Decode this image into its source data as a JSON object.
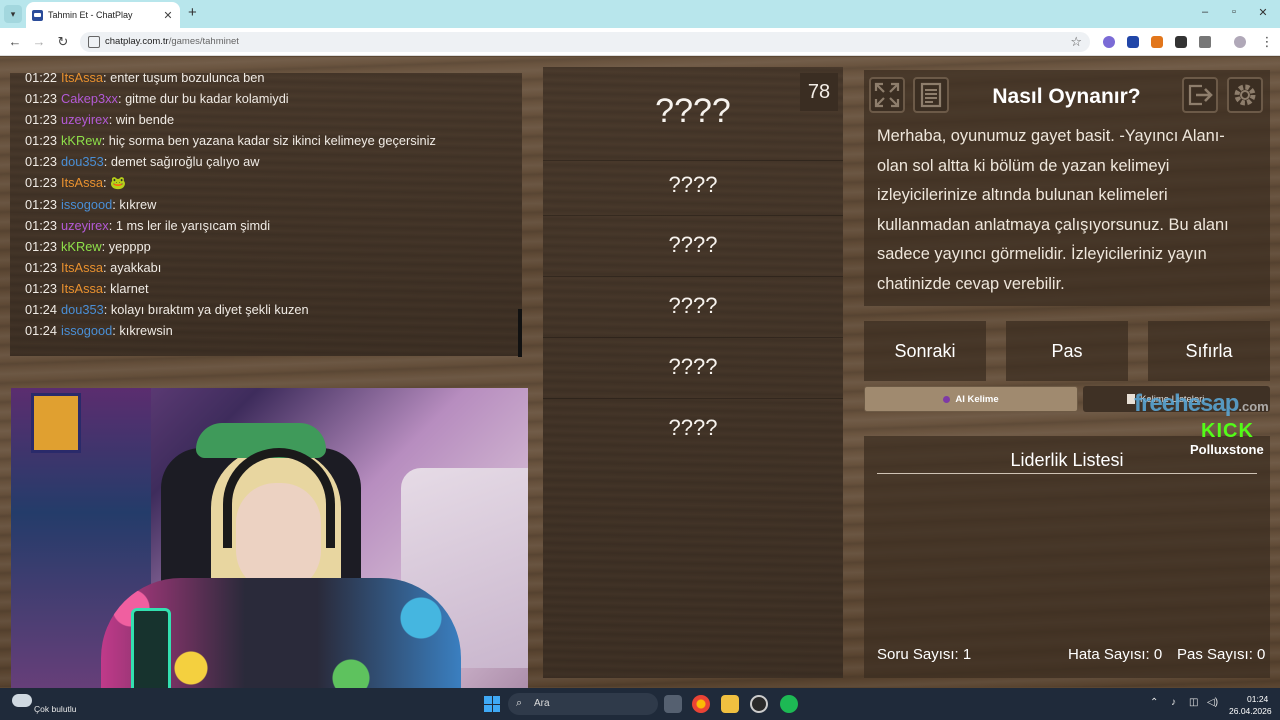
{
  "browser": {
    "tab_title": "Tahmin Et - ChatPlay",
    "new_tab": "+",
    "url_host": "chatplay.com.tr",
    "url_path": "/games/tahminet",
    "window_controls": [
      "–",
      "▫",
      "✕"
    ]
  },
  "chat": {
    "messages": [
      {
        "time": "01:22",
        "user": "ItsAssa",
        "color": "#e9912f",
        "text": "enter tuşum bozulunca ben"
      },
      {
        "time": "01:23",
        "user": "Cakep3xx",
        "color": "#b35ad6",
        "text": "gitme dur bu kadar kolamiydi"
      },
      {
        "time": "01:23",
        "user": "uzeyirex",
        "color": "#b35ad6",
        "text": "win bende"
      },
      {
        "time": "01:23",
        "user": "kKRew",
        "color": "#8ee04a",
        "text": "hiç sorma ben yazana kadar siz ikinci kelimeye geçersiniz"
      },
      {
        "time": "01:23",
        "user": "dou353",
        "color": "#4a8fd6",
        "text": "demet sağıroğlu çalıyo aw"
      },
      {
        "time": "01:23",
        "user": "ItsAssa",
        "color": "#e9912f",
        "text": "🐸"
      },
      {
        "time": "01:23",
        "user": "issogood",
        "color": "#4a8fd6",
        "text": "kıkrew"
      },
      {
        "time": "01:23",
        "user": "uzeyirex",
        "color": "#b35ad6",
        "text": "1 ms ler ile yarışıcam şimdi"
      },
      {
        "time": "01:23",
        "user": "kKRew",
        "color": "#8ee04a",
        "text": "yepppp"
      },
      {
        "time": "01:23",
        "user": "ItsAssa",
        "color": "#e9912f",
        "text": "ayakkabı"
      },
      {
        "time": "01:23",
        "user": "ItsAssa",
        "color": "#e9912f",
        "text": "klarnet"
      },
      {
        "time": "01:24",
        "user": "dou353",
        "color": "#4a8fd6",
        "text": "kolayı bıraktım ya diyet şekli kuzen"
      },
      {
        "time": "01:24",
        "user": "issogood",
        "color": "#4a8fd6",
        "text": "kıkrewsin"
      }
    ]
  },
  "game": {
    "counter": "78",
    "main_word": "????",
    "words": [
      "????",
      "????",
      "????",
      "????",
      "????"
    ],
    "howto_title": "Nasıl Oynanır?",
    "howto_text": "Merhaba, oyunumuz gayet basit. -Yayıncı Alanı- olan sol altta ki bölüm de yazan kelimeyi izleyicilerinize altında bulunan kelimeleri kullanmadan anlatmaya çalışıyorsunuz. Bu alanı sadece yayıncı görmelidir. İzleyicileriniz yayın chatinizde cevap verebilir.",
    "buttons": {
      "next": "Sonraki",
      "pass": "Pas",
      "reset": "Sıfırla"
    },
    "ai_button": "AI Kelime",
    "kelime_button": "Kelime Listeleri",
    "leaderboard_title": "Liderlik Listesi",
    "stats": {
      "question_label": "Soru Sayısı:",
      "question_value": "1",
      "error_label": "Hata Sayısı:",
      "error_value": "0",
      "pass_label": "Pas Sayısı:",
      "pass_value": "0"
    }
  },
  "watermark": {
    "domain": "freehesap",
    "domain_suffix": ".com",
    "platform": "KICK",
    "streamer": "Polluxstone"
  },
  "taskbar": {
    "weather": "Çok bulutlu",
    "search_placeholder": "Ara",
    "time": "01:24",
    "date": "26.04.2026"
  },
  "colors": {
    "accent_kick": "#53fc18",
    "taskbar": "#1f2a3a",
    "tabbar": "#b8e6ec"
  }
}
